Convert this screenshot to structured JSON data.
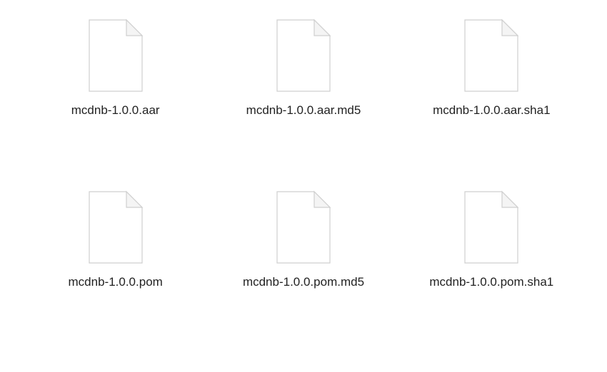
{
  "files": [
    {
      "name": "mcdnb-1.0.0.aar"
    },
    {
      "name": "mcdnb-1.0.0.aar.md5"
    },
    {
      "name": "mcdnb-1.0.0.aar.sha1"
    },
    {
      "name": "mcdnb-1.0.0.pom"
    },
    {
      "name": "mcdnb-1.0.0.pom.md5"
    },
    {
      "name": "mcdnb-1.0.0.pom.sha1"
    }
  ],
  "icon": {
    "semantic": "generic-document-icon"
  }
}
